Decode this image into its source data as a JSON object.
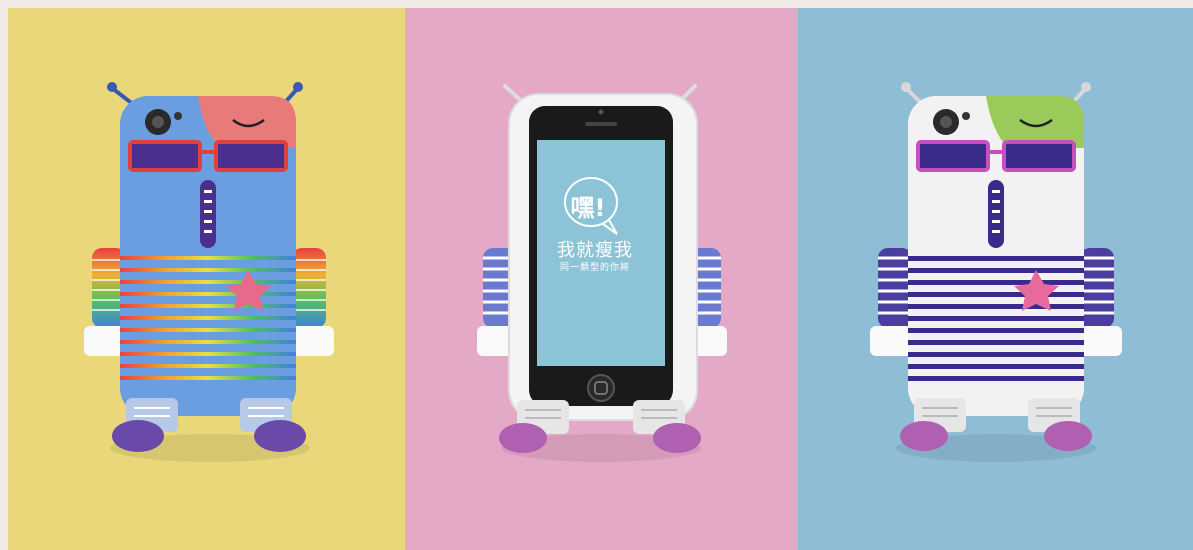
{
  "image": {
    "panels": [
      {
        "id": "yellow",
        "background": "#ead77a",
        "case_body": "#6a9ee0",
        "visor": "#e87a7a",
        "glasses": "#e0403c",
        "feet": "#6a4aa8"
      },
      {
        "id": "pink",
        "background": "#e5a9c8",
        "case_body": "#f4f4f4",
        "screen": "#8cc3d6",
        "feet": "#b060b0"
      },
      {
        "id": "blue",
        "background": "#8fbdd6",
        "case_body": "#f2f2f2",
        "visor": "#9acb5a",
        "glasses": "#c64fc0",
        "feet": "#b060b0"
      }
    ]
  },
  "screen": {
    "logo_text": "嘿!",
    "title": "我就瘦我",
    "subtitle": "同一類型的你將"
  }
}
